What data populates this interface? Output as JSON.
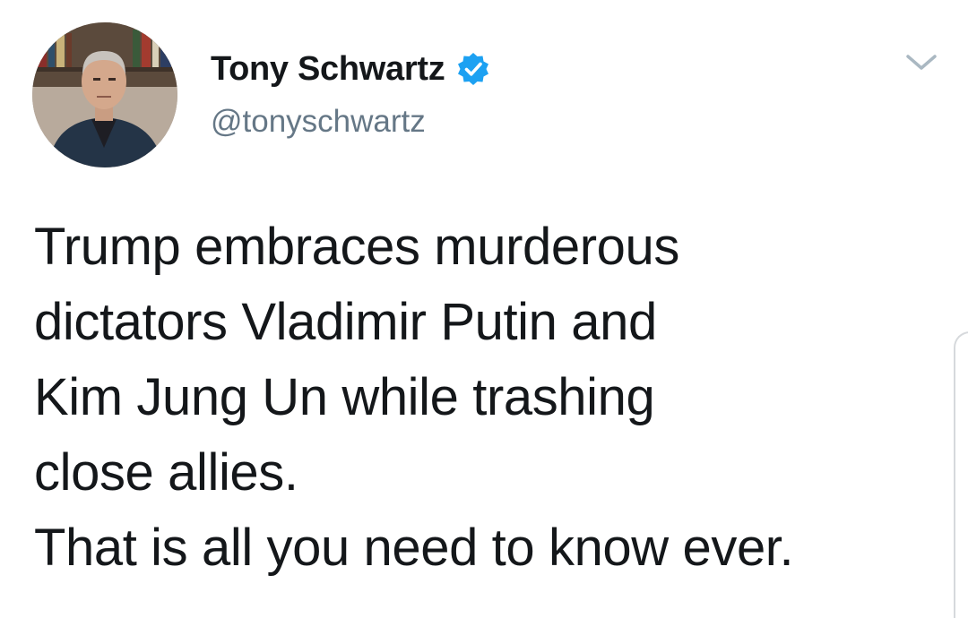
{
  "tweet": {
    "author": {
      "display_name": "Tony Schwartz",
      "handle": "@tonyschwartz",
      "verified": true,
      "verified_color": "#1da1f2",
      "avatar_icon": "profile-photo"
    },
    "menu_icon": "chevron-down-icon",
    "text_lines": [
      "Trump embraces murderous",
      "dictators Vladimir Putin and",
      "Kim Jung Un while trashing",
      "close allies.",
      "That is all you need to know ever."
    ]
  },
  "colors": {
    "text": "#14171a",
    "secondary": "#657786",
    "background": "#ffffff"
  }
}
